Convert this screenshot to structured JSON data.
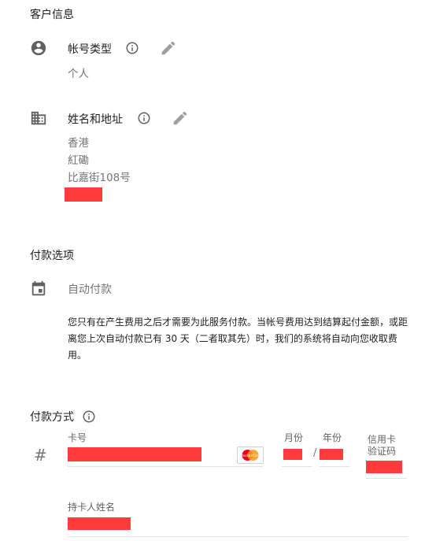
{
  "customer_info": {
    "title": "客户信息",
    "account_type": {
      "label": "帐号类型",
      "value": "个人"
    },
    "name_address": {
      "label": "姓名和地址",
      "lines": [
        "香港",
        "紅磡",
        "比嘉街108号"
      ]
    }
  },
  "payment_options": {
    "title": "付款选项",
    "auto_pay_label": "自动付款",
    "description": "您只有在产生费用之后才需要为此服务付款。当帐号费用达到结算起付金额，或距离您上次自动付款已有 30 天（二者取其先）时，我们的系统将自动向您收取费用。"
  },
  "payment_method": {
    "title": "付款方式",
    "card_number_label": "卡号",
    "month_label": "月份",
    "year_label": "年份",
    "cvc_label": "信用卡验证码",
    "expiry_separator": "/",
    "card_prefix_icon": "#",
    "card_brand": "MasterCard",
    "cardholder_label": "持卡人姓名"
  },
  "colors": {
    "redaction": "#ff3b3b",
    "icon": "#616161",
    "divider": "#e0e0e0"
  }
}
